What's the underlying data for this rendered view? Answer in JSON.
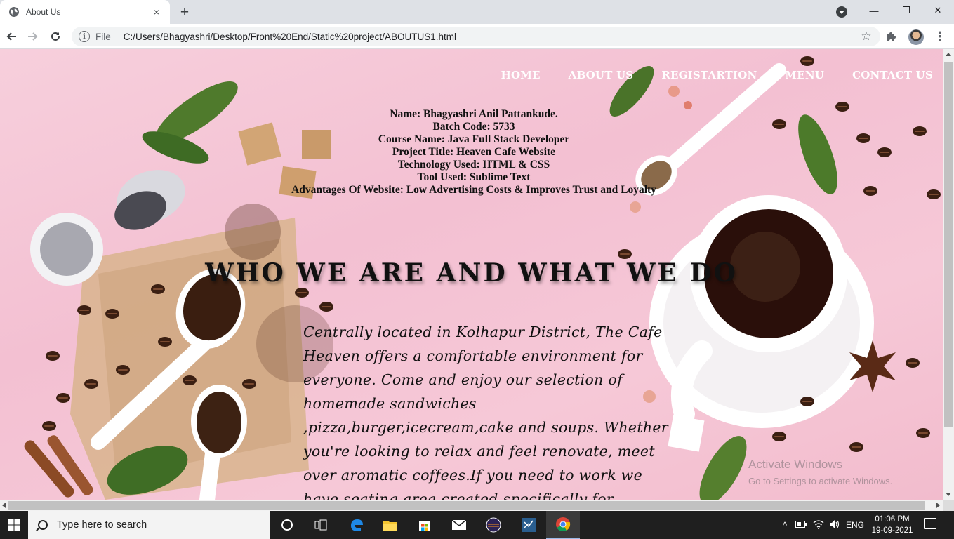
{
  "browser": {
    "tab_title": "About Us",
    "tab_close": "×",
    "new_tab": "+",
    "window_controls": {
      "minimize": "—",
      "maximize": "❐",
      "close": "✕"
    },
    "file_label": "File",
    "url": "C:/Users/Bhagyashri/Desktop/Front%20End/Static%20project/ABOUTUS1.html",
    "star": "☆",
    "extensions": "✚",
    "menu": "⋮"
  },
  "page": {
    "nav": [
      "HOME",
      "ABOUT US",
      "REGISTARTION",
      "MENU",
      "CONTACT US"
    ],
    "info_lines": [
      "Name: Bhagyashri Anil Pattankude.",
      "Batch Code: 5733",
      "Course Name: Java Full Stack Developer",
      "Project Title: Heaven Cafe Website",
      "Technology Used: HTML & CSS",
      "Tool Used: Sublime Text",
      "Advantages Of Website: Low Advertising Costs & Improves Trust and Loyalty"
    ],
    "headline": "WHO WE ARE AND WHAT WE DO",
    "paragraph": "Centrally located in Kolhapur District, The Cafe Heaven offers a comfortable environment for everyone. Come and enjoy our selection of homemade sandwiches ,pizza,burger,icecream,cake and soups. Whether you're looking to relax and feel renovate, meet over aromatic coffees.If you need to work we have seating area created specifically for you.We offer a delicious variety of"
  },
  "watermark": {
    "line1": "Activate Windows",
    "line2": "Go to Settings to activate Windows."
  },
  "taskbar": {
    "search_placeholder": "Type here to search",
    "language": "ENG",
    "time": "01:06 PM",
    "date": "19-09-2021",
    "pinned_icons": [
      "task-view-icon",
      "edge-icon",
      "file-explorer-icon",
      "store-icon",
      "mail-icon",
      "eclipse-icon",
      "visual-studio-icon",
      "chrome-icon"
    ]
  },
  "colors": {
    "page_bg": "#f3c0d2",
    "nav_text": "#ffffff",
    "taskbar": "#1f1f1f"
  }
}
